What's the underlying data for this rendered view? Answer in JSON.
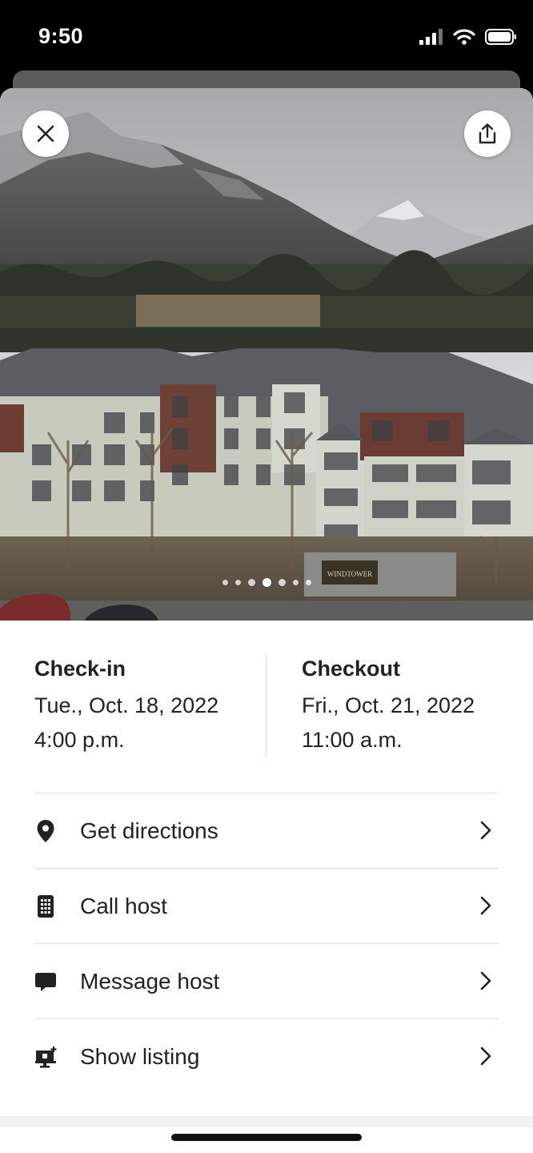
{
  "status_bar": {
    "time": "9:50"
  },
  "hero": {
    "image_description": "",
    "dots_total": 7,
    "active_dot": 4,
    "sign_text": "WINDTOWER"
  },
  "buttons": {
    "close_icon": "close-icon",
    "share_icon": "share-icon"
  },
  "check_in": {
    "label": "Check-in",
    "date": "Tue., Oct. 18, 2022",
    "time": "4:00 p.m."
  },
  "checkout": {
    "label": "Checkout",
    "date": "Fri., Oct. 21, 2022",
    "time": "11:00 a.m."
  },
  "actions": [
    {
      "label": "Get directions",
      "icon": "map-pin-icon"
    },
    {
      "label": "Call host",
      "icon": "phone-keypad-icon"
    },
    {
      "label": "Message host",
      "icon": "message-icon"
    },
    {
      "label": "Show listing",
      "icon": "listing-icon"
    }
  ],
  "colors": {
    "text": "#222222",
    "divider": "#dedede",
    "background": "#ffffff"
  }
}
